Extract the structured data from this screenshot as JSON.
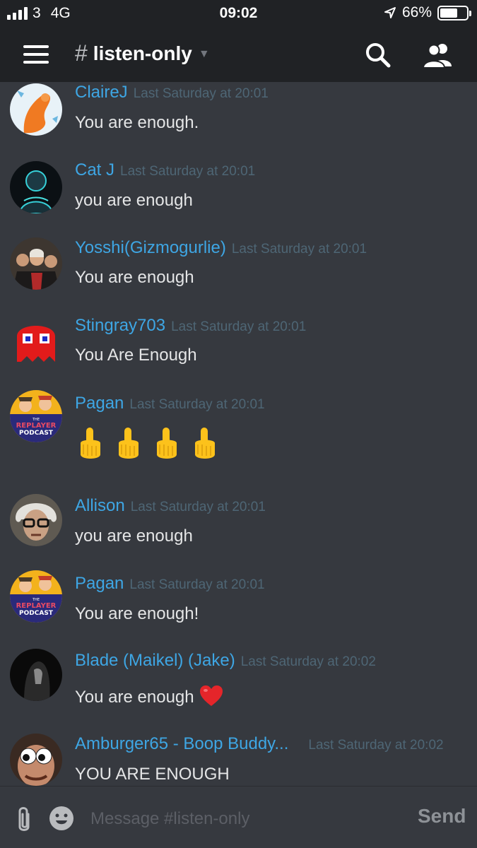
{
  "status_bar": {
    "carrier": "3",
    "network": "4G",
    "time": "09:02",
    "battery_text": "66%",
    "battery_level": 0.66
  },
  "header": {
    "channel_hash": "#",
    "channel_name": "listen-only",
    "menu_icon": "hamburger-icon",
    "search_icon": "search-icon",
    "members_icon": "members-icon"
  },
  "messages": [
    {
      "username": "ClaireJ",
      "timestamp": "Last Saturday at 20:01",
      "text": "You are enough."
    },
    {
      "username": "Cat J",
      "timestamp": "Last Saturday at 20:01",
      "text": "you are enough"
    },
    {
      "username": "Yosshi(Gizmogurlie)",
      "timestamp": "Last Saturday at 20:01",
      "text": "You are enough"
    },
    {
      "username": "Stingray703",
      "timestamp": "Last Saturday at 20:01",
      "text": "You Are Enough"
    },
    {
      "username": "Pagan",
      "timestamp": "Last Saturday at 20:01",
      "text": "👆👆👆👆",
      "avatar_text": [
        "THE",
        "REPLAYER",
        "PODCAST"
      ]
    },
    {
      "username": "Allison",
      "timestamp": "Last Saturday at 20:01",
      "text": "you are enough"
    },
    {
      "username": "Pagan",
      "timestamp": "Last Saturday at 20:01",
      "text": "You are enough!",
      "avatar_text": [
        "THE",
        "REPLAYER",
        "PODCAST"
      ]
    },
    {
      "username": "Blade (Maikel) (Jake)",
      "timestamp": "Last Saturday at 20:02",
      "text": "You are enough",
      "emoji": "heart-emoji"
    },
    {
      "username": "Amburger65 - Boop Buddy...",
      "timestamp": "Last Saturday at 20:02",
      "text": "YOU ARE ENOUGH"
    }
  ],
  "composer": {
    "placeholder": "Message #listen-only",
    "send_label": "Send",
    "attach_icon": "paperclip-icon",
    "emoji_icon": "emoji-icon"
  },
  "colors": {
    "background": "#36393f",
    "header": "#202225",
    "username": "#3ea6e4",
    "timestamp": "#4e6675",
    "message_text": "#e4e5e6"
  }
}
